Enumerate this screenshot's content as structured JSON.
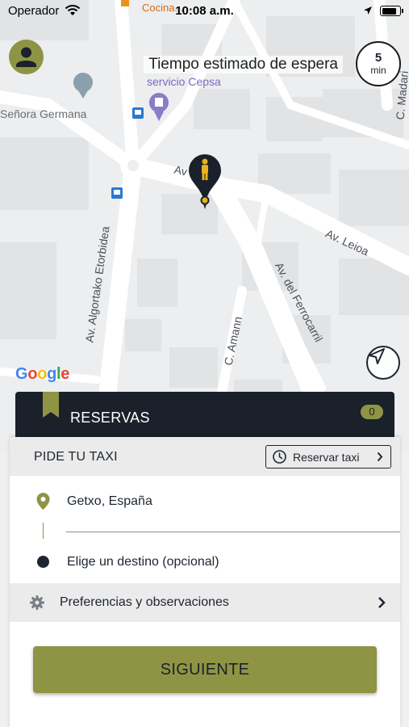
{
  "status_bar": {
    "carrier": "Operador",
    "time": "10:08 a.m."
  },
  "map": {
    "labels": {
      "cocina": "Cocina...",
      "cepsa": "servicio Cepsa",
      "senora": "Señora Germana",
      "av_short": "Av",
      "av_leioa": "Av. Leioa",
      "ferrocarril": "Av. del Ferrocarril",
      "algortako": "Av. Algortako Etorbidea",
      "amann": "C. Amann",
      "madari": "C. Madari"
    },
    "google_logo": "Google",
    "colors": {
      "pin": "#1a212b",
      "pin_person": "#e8b31c",
      "accent": "#8f9444"
    }
  },
  "wait_time": {
    "label": "Tiempo estimado de espera",
    "value": "5",
    "unit": "min"
  },
  "reservas": {
    "label": "RESERVAS",
    "count": "0"
  },
  "card": {
    "title": "PIDE TU TAXI",
    "reserve_button": "Reservar taxi",
    "origin": "Getxo, España",
    "destination_placeholder": "Elige un destino (opcional)",
    "preferences": "Preferencias y observaciones",
    "next_button": "SIGUIENTE"
  },
  "icons": {
    "avatar": "user-avatar-icon",
    "locate": "navigation-arrow-icon",
    "clock": "clock-icon",
    "gear": "gear-icon",
    "origin_pin": "location-pin-icon",
    "chevron": "chevron-right-icon"
  }
}
